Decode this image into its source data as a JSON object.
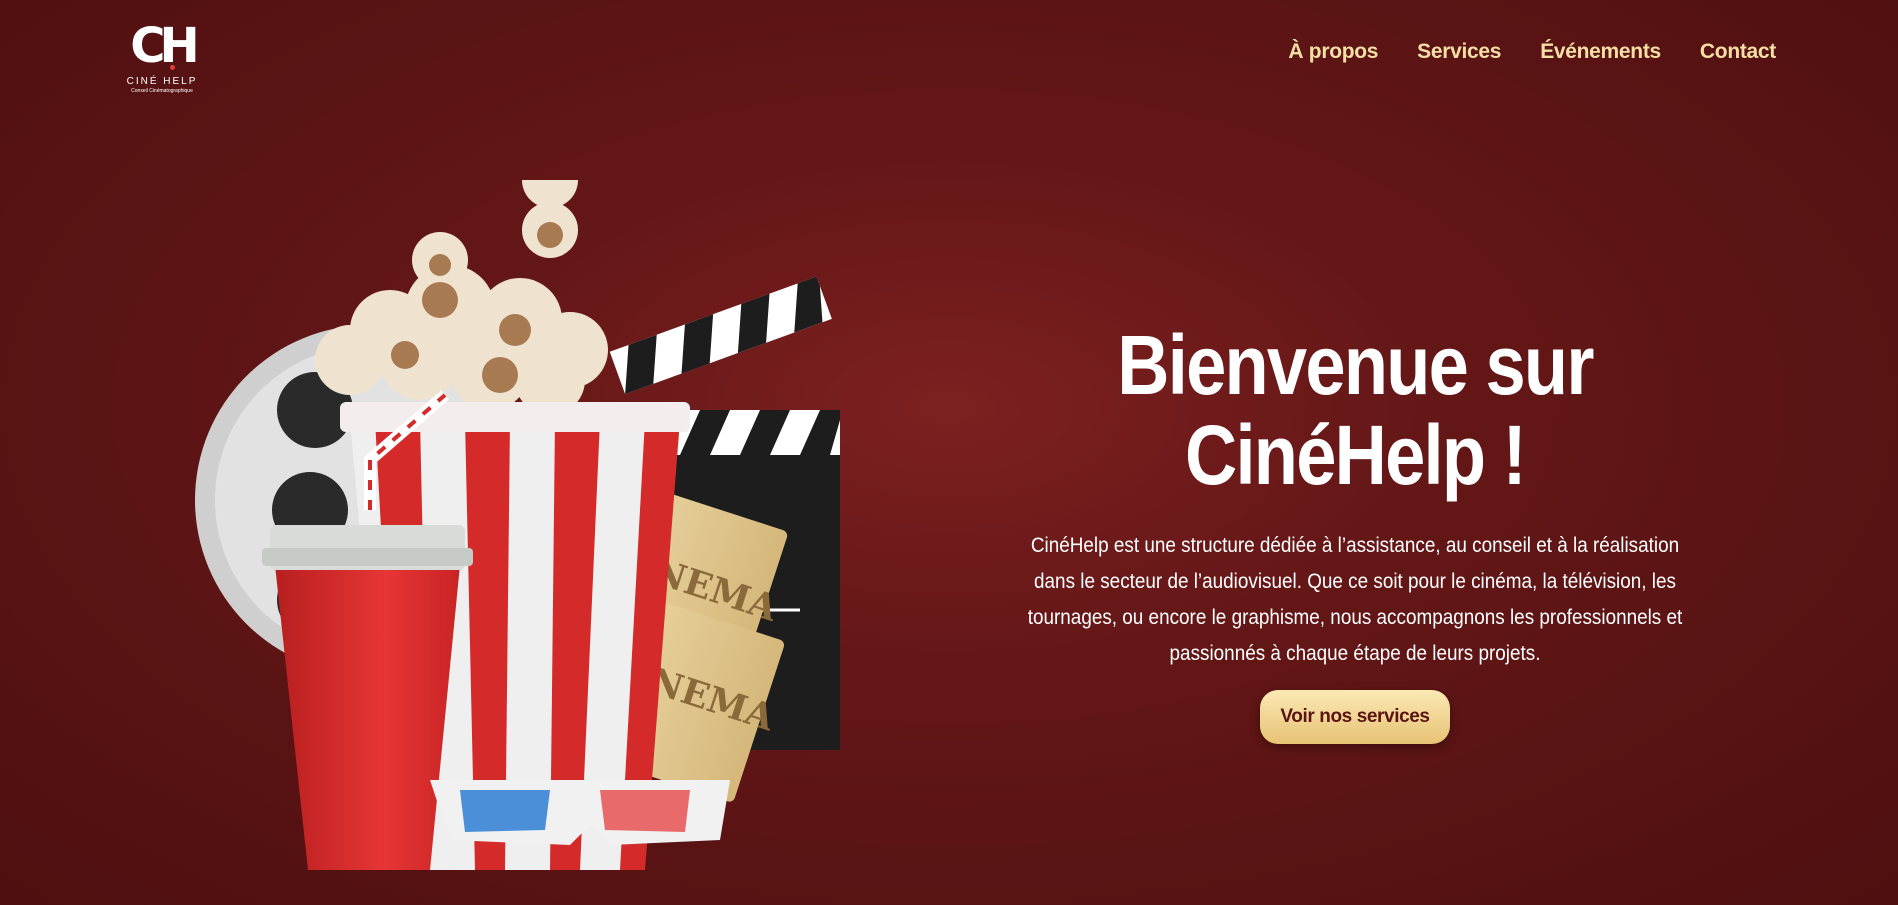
{
  "logo": {
    "mark": "CH",
    "name": "CINÉ HELP",
    "tagline": "Conseil Cinématographique"
  },
  "nav": {
    "items": [
      {
        "label": "À propos"
      },
      {
        "label": "Services"
      },
      {
        "label": "Événements"
      },
      {
        "label": "Contact"
      }
    ]
  },
  "hero": {
    "title_line1": "Bienvenue sur",
    "title_line2": "CinéHelp !",
    "description": "CinéHelp est une structure dédiée à l’assistance, au conseil et à la réalisation dans le secteur de l’audiovisuel. Que ce soit pour le cinéma, la télévision, les tournages, ou encore le graphisme, nous accompagnons les professionnels et passionnés à chaque étape de leurs projets.",
    "cta_label": "Voir nos services"
  },
  "illustration": {
    "ticket_text": "CINEMA"
  },
  "colors": {
    "background": "#6b1a1a",
    "nav_text": "#f6dfa4",
    "cta_bg": "#f2d68f",
    "cta_text": "#5a1414"
  }
}
